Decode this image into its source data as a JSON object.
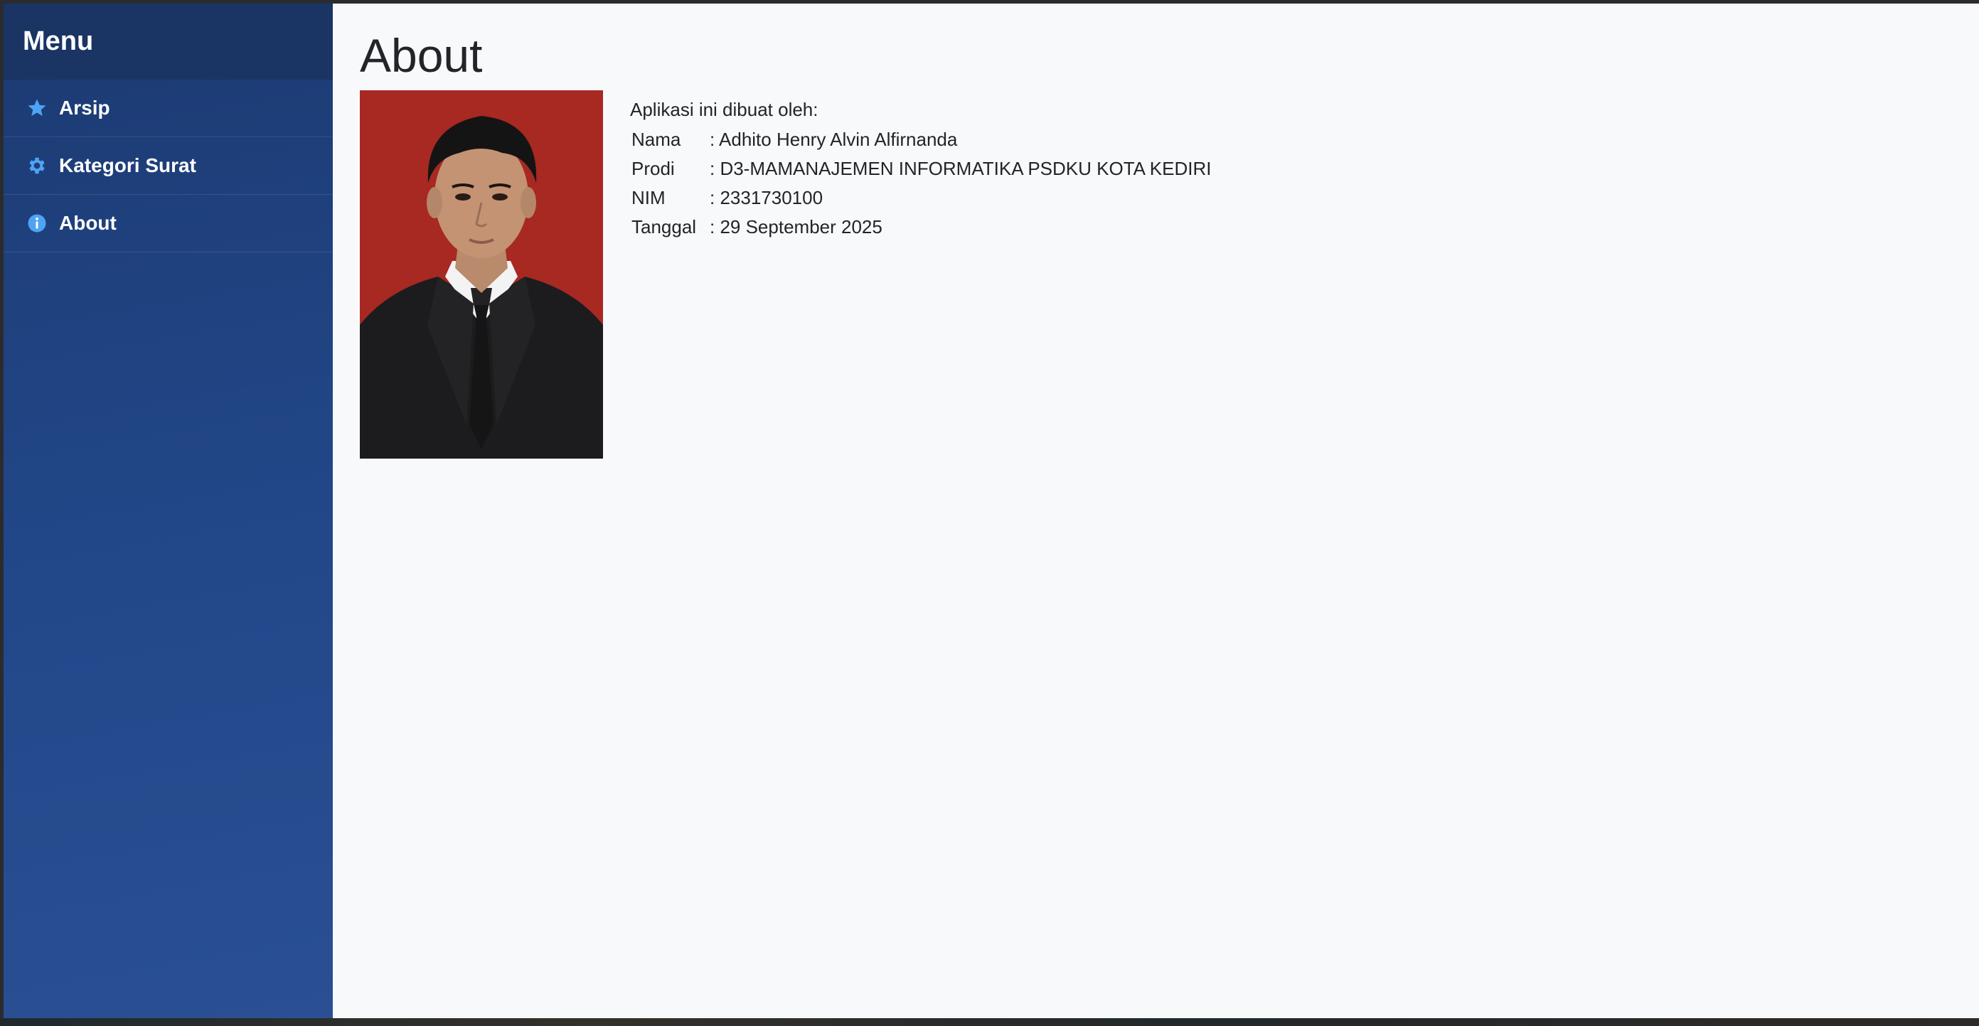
{
  "sidebar": {
    "title": "Menu",
    "items": [
      {
        "label": "Arsip",
        "icon": "star-icon"
      },
      {
        "label": "Kategori Surat",
        "icon": "gear-icon"
      },
      {
        "label": "About",
        "icon": "info-icon"
      }
    ]
  },
  "main": {
    "title": "About",
    "intro": "Aplikasi ini dibuat oleh:",
    "details": [
      {
        "label": "Nama",
        "value": ": Adhito Henry Alvin Alfirnanda"
      },
      {
        "label": "Prodi",
        "value": ": D3-MAMANAJEMEN INFORMATIKA PSDKU KOTA KEDIRI"
      },
      {
        "label": "NIM",
        "value": ": 2331730100"
      },
      {
        "label": "Tanggal",
        "value": ": 29 September 2025"
      }
    ]
  },
  "colors": {
    "sidebar_top": "#1c3a72",
    "sidebar_bottom": "#2a4f93",
    "icon_accent": "#4ea3f5",
    "photo_background": "#a82822",
    "content_background": "#f8f9fa"
  }
}
